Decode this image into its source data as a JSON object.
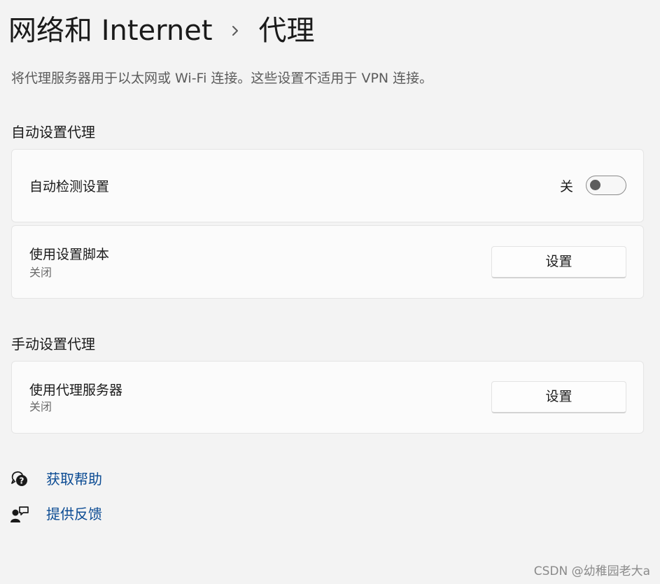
{
  "breadcrumb": {
    "parent": "网络和 Internet",
    "current": "代理"
  },
  "description": "将代理服务器用于以太网或 Wi-Fi 连接。这些设置不适用于 VPN 连接。",
  "auto_section": {
    "title": "自动设置代理",
    "detect": {
      "label": "自动检测设置",
      "state_label": "关",
      "enabled": false
    },
    "script": {
      "label": "使用设置脚本",
      "status": "关闭",
      "button_label": "设置"
    }
  },
  "manual_section": {
    "title": "手动设置代理",
    "proxy": {
      "label": "使用代理服务器",
      "status": "关闭",
      "button_label": "设置"
    }
  },
  "links": [
    {
      "label": "获取帮助",
      "icon": "help-chat-icon"
    },
    {
      "label": "提供反馈",
      "icon": "feedback-person-icon"
    }
  ],
  "watermark": "CSDN @幼稚园老大a",
  "colors": {
    "background": "#f3f3f3",
    "card": "#fbfbfb",
    "link": "#0b4b93",
    "text": "#1a1a1a",
    "muted": "#6a6a6a"
  }
}
